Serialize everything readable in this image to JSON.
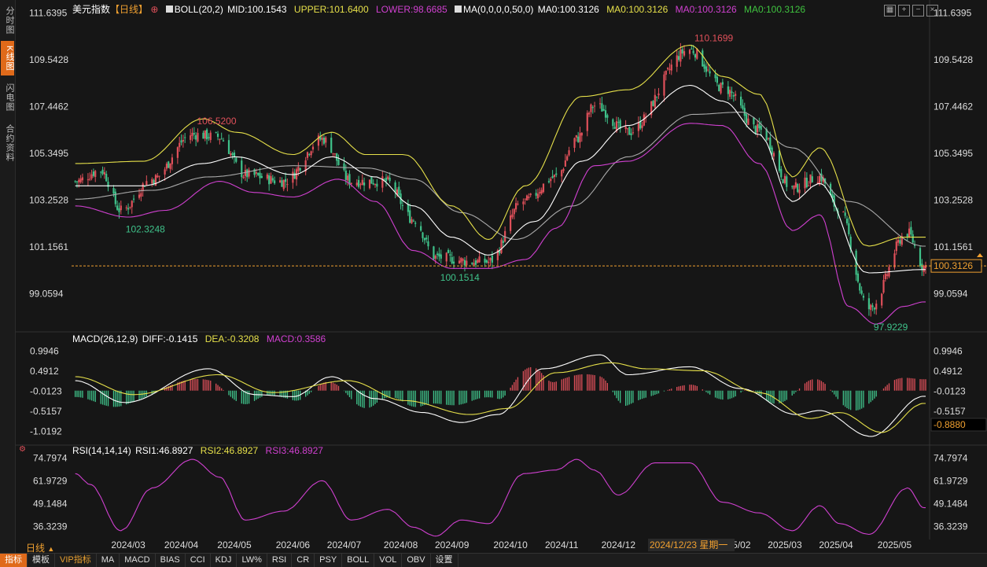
{
  "sidebar": {
    "tabs": [
      {
        "label": "分时图",
        "active": false
      },
      {
        "label": "K线图",
        "active": true
      },
      {
        "label": "闪电图",
        "active": false
      },
      {
        "label": "合约资料",
        "active": false
      }
    ]
  },
  "header": {
    "title": "美元指数",
    "period": "【日线】",
    "add_icon": "plus-circle-icon",
    "boll": "BOLL(20,2)",
    "mid": "MID:100.1543",
    "upper": "UPPER:101.6400",
    "lower": "LOWER:98.6685",
    "ma": "MA(0,0,0,0,50,0)",
    "ma1": "MA0:100.3126",
    "ma2": "MA0:100.3126",
    "ma3": "MA0:100.3126",
    "ma4": "MA0:100.3126"
  },
  "macd_header": {
    "name": "MACD(26,12,9)",
    "diff": "DIFF:-0.1415",
    "dea": "DEA:-0.3208",
    "macd": "MACD:0.3586"
  },
  "rsi_header": {
    "name": "RSI(14,14,14)",
    "rsi1": "RSI1:46.8927",
    "rsi2": "RSI2:46.8927",
    "rsi3": "RSI3:46.8927"
  },
  "toolbar_icons": [
    "grid-icon",
    "crosshair-icon",
    "minus-icon",
    "close-icon"
  ],
  "colors": {
    "up": "#e0505a",
    "down": "#3fc28a",
    "mid": "#ffffff",
    "upper": "#e6e04a",
    "lower": "#d040d0",
    "ma50": "#aaaaaa",
    "dea": "#e6e04a",
    "diff": "#ffffff",
    "rsi": "#d040d0",
    "last": "#f0a030"
  },
  "main_axis": {
    "ticks": [
      "111.6395",
      "109.5428",
      "107.4462",
      "105.3495",
      "103.2528",
      "101.1561",
      "99.0594"
    ]
  },
  "macd_axis": {
    "ticks": [
      "0.9946",
      "0.4912",
      "-0.0123",
      "-0.5157",
      "-1.0192"
    ]
  },
  "rsi_axis": {
    "ticks": [
      "74.7974",
      "61.9729",
      "49.1484",
      "36.3239"
    ]
  },
  "last_price": "100.3126",
  "macd_cursor_value": "-0.8880",
  "annotations": {
    "high": "110.1699",
    "low_2024_08": "100.1514",
    "high_2024_04": "106.5200",
    "low_2024_03": "102.3248",
    "low_2025_04": "97.9229"
  },
  "x_axis": {
    "labels": [
      "2024/03",
      "2024/04",
      "2024/05",
      "2024/06",
      "2024/07",
      "2024/08",
      "2024/09",
      "2024/10",
      "2024/11",
      "2024/12",
      "2025/02",
      "2025/03",
      "2025/04",
      "2025/05"
    ],
    "cursor_label": "2024/12/23 星期一"
  },
  "period_label": "日线",
  "bottom_bar": [
    {
      "label": "指标",
      "active": true
    },
    {
      "label": "模板"
    },
    {
      "label": "VIP指标",
      "vip": true
    },
    {
      "label": "MA"
    },
    {
      "label": "MACD"
    },
    {
      "label": "BIAS"
    },
    {
      "label": "CCI"
    },
    {
      "label": "KDJ"
    },
    {
      "label": "LW%"
    },
    {
      "label": "RSI"
    },
    {
      "label": "CR"
    },
    {
      "label": "PSY"
    },
    {
      "label": "BOLL"
    },
    {
      "label": "VOL"
    },
    {
      "label": "OBV"
    },
    {
      "label": "设置"
    }
  ],
  "chart_data": {
    "type": "line",
    "title": "美元指数",
    "price_range": [
      97.5,
      111.8
    ],
    "close_anchors": [
      [
        "2024-02-12",
        104.1
      ],
      [
        "2024-02-26",
        104.6
      ],
      [
        "2024-03-08",
        102.8
      ],
      [
        "2024-03-25",
        104.2
      ],
      [
        "2024-04-16",
        106.2
      ],
      [
        "2024-04-30",
        106.1
      ],
      [
        "2024-05-15",
        104.4
      ],
      [
        "2024-06-05",
        104.1
      ],
      [
        "2024-06-26",
        106.0
      ],
      [
        "2024-07-12",
        104.1
      ],
      [
        "2024-07-31",
        104.1
      ],
      [
        "2024-08-15",
        102.4
      ],
      [
        "2024-08-27",
        100.7
      ],
      [
        "2024-09-17",
        100.5
      ],
      [
        "2024-09-25",
        100.5
      ],
      [
        "2024-10-14",
        103.2
      ],
      [
        "2024-11-01",
        104.3
      ],
      [
        "2024-11-12",
        106.0
      ],
      [
        "2024-11-22",
        107.5
      ],
      [
        "2024-12-10",
        106.3
      ],
      [
        "2025-01-13",
        110.0
      ],
      [
        "2025-01-31",
        108.3
      ],
      [
        "2025-02-20",
        106.4
      ],
      [
        "2025-03-10",
        103.8
      ],
      [
        "2025-03-25",
        104.3
      ],
      [
        "2025-04-04",
        102.9
      ],
      [
        "2025-04-21",
        98.4
      ],
      [
        "2025-05-12",
        101.8
      ],
      [
        "2025-05-21",
        100.3
      ]
    ],
    "boll_upper_anchors": [
      [
        "2024-02-12",
        104.9
      ],
      [
        "2024-03-20",
        105.0
      ],
      [
        "2024-04-22",
        106.9
      ],
      [
        "2024-05-10",
        106.3
      ],
      [
        "2024-06-10",
        105.3
      ],
      [
        "2024-07-01",
        106.3
      ],
      [
        "2024-07-20",
        105.3
      ],
      [
        "2024-08-10",
        105.3
      ],
      [
        "2024-09-05",
        103.0
      ],
      [
        "2024-09-25",
        101.5
      ],
      [
        "2024-10-15",
        103.9
      ],
      [
        "2024-11-15",
        107.9
      ],
      [
        "2024-12-10",
        108.2
      ],
      [
        "2025-01-13",
        110.2
      ],
      [
        "2025-01-31",
        108.8
      ],
      [
        "2025-02-20",
        108.0
      ],
      [
        "2025-03-10",
        104.3
      ],
      [
        "2025-03-25",
        105.6
      ],
      [
        "2025-04-20",
        101.2
      ],
      [
        "2025-05-10",
        101.6
      ],
      [
        "2025-05-21",
        101.6
      ]
    ],
    "boll_lower_anchors": [
      [
        "2024-02-12",
        103.0
      ],
      [
        "2024-03-12",
        102.5
      ],
      [
        "2024-04-01",
        102.8
      ],
      [
        "2024-05-01",
        104.1
      ],
      [
        "2024-05-20",
        103.6
      ],
      [
        "2024-06-10",
        103.4
      ],
      [
        "2024-07-05",
        104.2
      ],
      [
        "2024-07-25",
        103.2
      ],
      [
        "2024-08-15",
        101.0
      ],
      [
        "2024-09-05",
        100.2
      ],
      [
        "2024-09-25",
        100.2
      ],
      [
        "2024-10-15",
        100.6
      ],
      [
        "2024-11-01",
        102.0
      ],
      [
        "2024-11-22",
        104.8
      ],
      [
        "2024-12-10",
        105.0
      ],
      [
        "2025-01-13",
        106.7
      ],
      [
        "2025-01-31",
        106.6
      ],
      [
        "2025-02-20",
        104.9
      ],
      [
        "2025-03-10",
        101.9
      ],
      [
        "2025-03-25",
        102.6
      ],
      [
        "2025-04-10",
        98.5
      ],
      [
        "2025-04-25",
        97.7
      ],
      [
        "2025-05-10",
        98.5
      ],
      [
        "2025-05-21",
        98.7
      ]
    ],
    "boll_mid_anchors": [
      [
        "2024-02-12",
        103.9
      ],
      [
        "2024-03-20",
        103.9
      ],
      [
        "2024-04-22",
        104.9
      ],
      [
        "2024-05-10",
        105.2
      ],
      [
        "2024-06-10",
        104.4
      ],
      [
        "2024-07-01",
        105.2
      ],
      [
        "2024-07-25",
        104.3
      ],
      [
        "2024-08-15",
        103.0
      ],
      [
        "2024-09-05",
        101.6
      ],
      [
        "2024-09-25",
        100.8
      ],
      [
        "2024-10-20",
        102.3
      ],
      [
        "2024-11-15",
        105.0
      ],
      [
        "2024-12-10",
        106.6
      ],
      [
        "2025-01-13",
        108.4
      ],
      [
        "2025-01-31",
        107.7
      ],
      [
        "2025-02-20",
        106.2
      ],
      [
        "2025-03-10",
        103.2
      ],
      [
        "2025-03-25",
        104.0
      ],
      [
        "2025-04-20",
        100.0
      ],
      [
        "2025-05-21",
        100.15
      ]
    ],
    "ma50_anchors": [
      [
        "2024-02-12",
        103.3
      ],
      [
        "2024-03-25",
        103.7
      ],
      [
        "2024-04-25",
        104.3
      ],
      [
        "2024-06-10",
        104.8
      ],
      [
        "2024-07-20",
        104.7
      ],
      [
        "2024-08-15",
        104.2
      ],
      [
        "2024-09-10",
        102.7
      ],
      [
        "2024-10-10",
        101.5
      ],
      [
        "2024-11-10",
        103.0
      ],
      [
        "2024-12-10",
        105.2
      ],
      [
        "2025-01-15",
        107.1
      ],
      [
        "2025-02-10",
        107.2
      ],
      [
        "2025-03-10",
        105.6
      ],
      [
        "2025-04-10",
        103.2
      ],
      [
        "2025-05-21",
        101.2
      ]
    ],
    "macd_range": [
      -1.25,
      1.2
    ],
    "diff_anchors": [
      [
        "2024-02-12",
        0.25
      ],
      [
        "2024-03-10",
        -0.3
      ],
      [
        "2024-04-25",
        0.55
      ],
      [
        "2024-05-20",
        -0.1
      ],
      [
        "2024-06-10",
        -0.15
      ],
      [
        "2024-07-01",
        0.35
      ],
      [
        "2024-07-25",
        -0.2
      ],
      [
        "2024-08-20",
        -0.55
      ],
      [
        "2024-09-10",
        -0.8
      ],
      [
        "2024-09-30",
        -0.6
      ],
      [
        "2024-10-25",
        0.55
      ],
      [
        "2024-11-25",
        0.9
      ],
      [
        "2024-12-10",
        0.4
      ],
      [
        "2025-01-13",
        0.6
      ],
      [
        "2025-02-10",
        0.05
      ],
      [
        "2025-03-12",
        -0.6
      ],
      [
        "2025-03-25",
        -0.5
      ],
      [
        "2025-04-22",
        -1.15
      ],
      [
        "2025-05-21",
        -0.1415
      ]
    ],
    "dea_anchors": [
      [
        "2024-02-12",
        0.35
      ],
      [
        "2024-03-15",
        -0.1
      ],
      [
        "2024-04-30",
        0.4
      ],
      [
        "2024-05-30",
        -0.05
      ],
      [
        "2024-07-10",
        0.25
      ],
      [
        "2024-08-10",
        -0.25
      ],
      [
        "2024-09-15",
        -0.6
      ],
      [
        "2024-10-05",
        -0.45
      ],
      [
        "2024-11-01",
        0.45
      ],
      [
        "2024-12-01",
        0.7
      ],
      [
        "2024-12-20",
        0.55
      ],
      [
        "2025-01-20",
        0.5
      ],
      [
        "2025-02-20",
        -0.05
      ],
      [
        "2025-03-20",
        -0.7
      ],
      [
        "2025-04-05",
        -0.55
      ],
      [
        "2025-04-28",
        -1.05
      ],
      [
        "2025-05-21",
        -0.3208
      ]
    ],
    "rsi_range": [
      30,
      78
    ],
    "rsi_anchors": [
      [
        "2024-02-12",
        66
      ],
      [
        "2024-02-20",
        60
      ],
      [
        "2024-03-08",
        34
      ],
      [
        "2024-03-25",
        58
      ],
      [
        "2024-04-16",
        74
      ],
      [
        "2024-05-01",
        64
      ],
      [
        "2024-05-15",
        40
      ],
      [
        "2024-06-05",
        45
      ],
      [
        "2024-06-26",
        62
      ],
      [
        "2024-07-12",
        40
      ],
      [
        "2024-08-01",
        46
      ],
      [
        "2024-08-15",
        36
      ],
      [
        "2024-08-27",
        31
      ],
      [
        "2024-09-10",
        40
      ],
      [
        "2024-09-25",
        38
      ],
      [
        "2024-10-14",
        66
      ],
      [
        "2024-11-01",
        68
      ],
      [
        "2024-11-12",
        74
      ],
      [
        "2024-11-22",
        68
      ],
      [
        "2024-12-05",
        54
      ],
      [
        "2024-12-25",
        72
      ],
      [
        "2025-01-13",
        72
      ],
      [
        "2025-01-31",
        50
      ],
      [
        "2025-02-20",
        44
      ],
      [
        "2025-03-10",
        34
      ],
      [
        "2025-03-25",
        48
      ],
      [
        "2025-04-05",
        38
      ],
      [
        "2025-04-21",
        32
      ],
      [
        "2025-05-12",
        58
      ],
      [
        "2025-05-21",
        46.8927
      ]
    ]
  }
}
